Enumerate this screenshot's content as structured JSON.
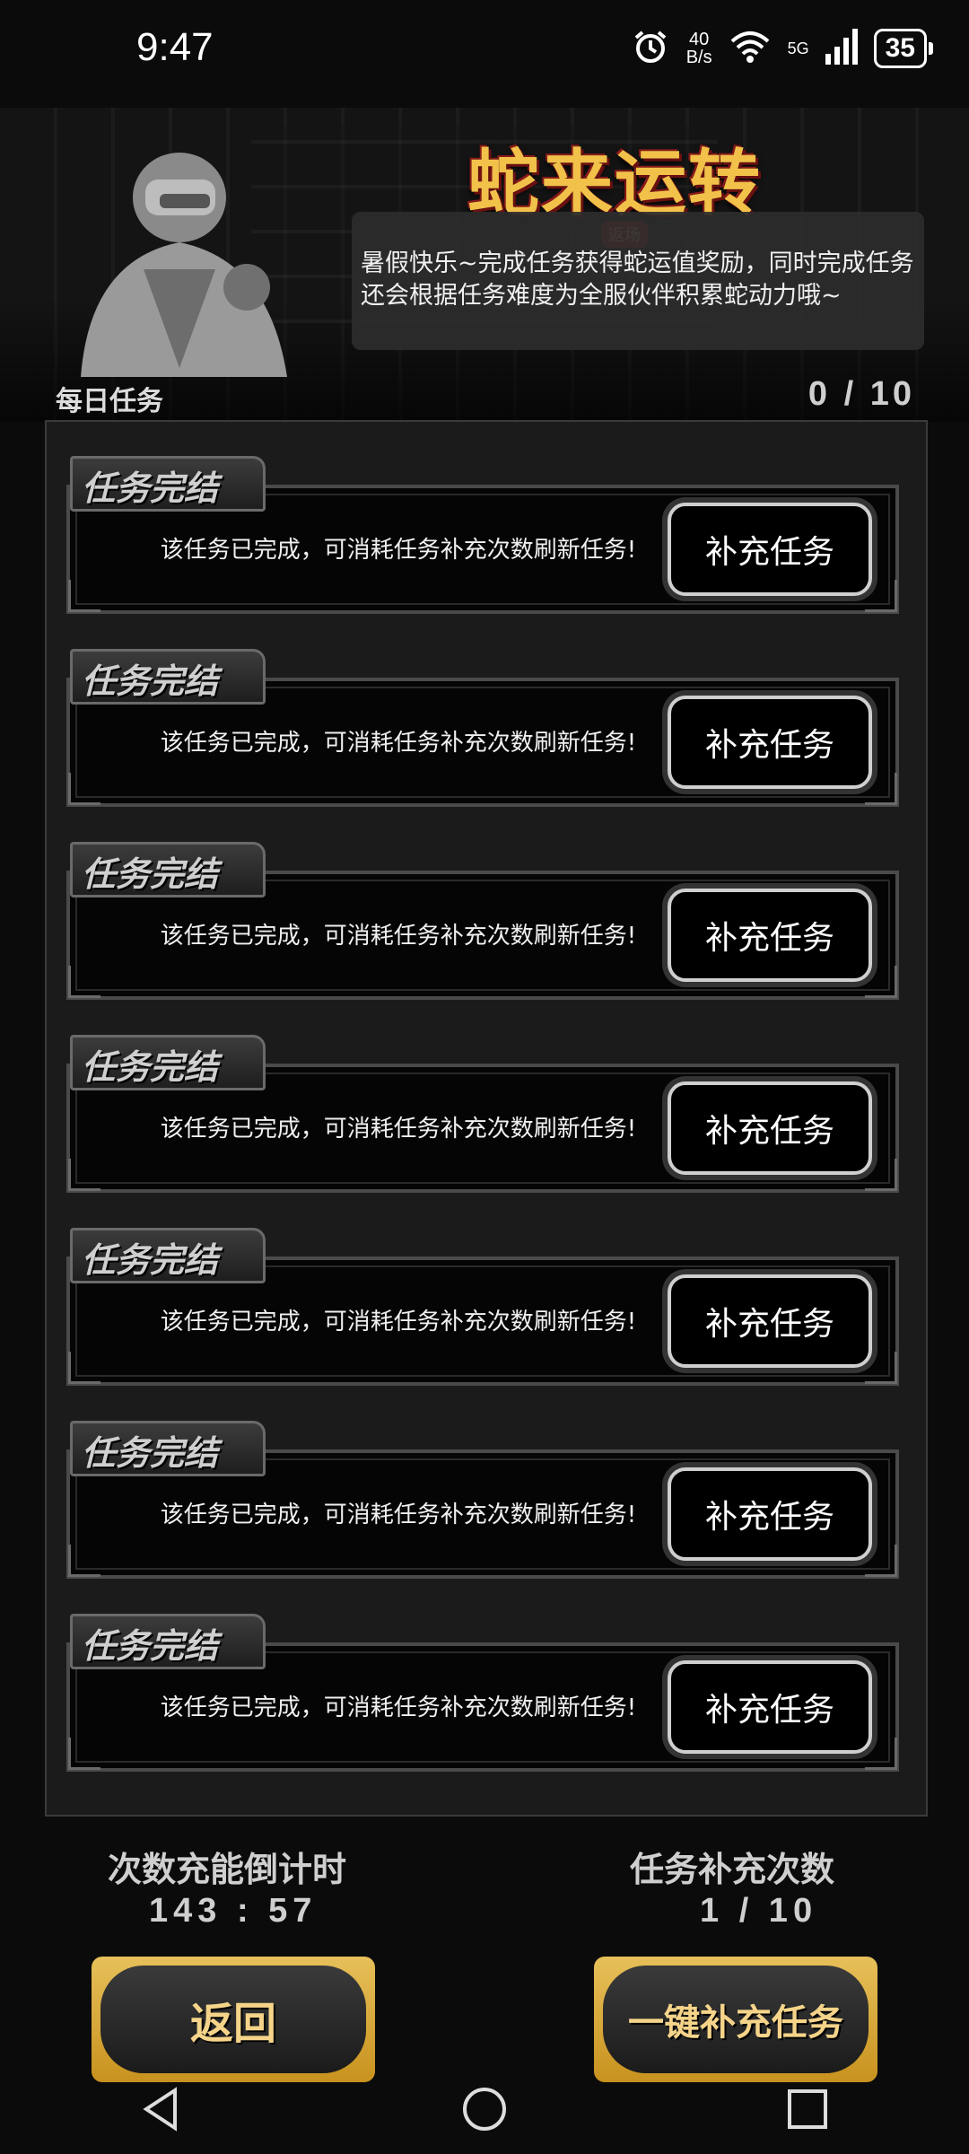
{
  "status_bar": {
    "time": "9:47",
    "net_speed_value": "40",
    "net_speed_unit": "B/s",
    "signal": "5G",
    "battery": "35",
    "icons": [
      "alarm-icon",
      "wifi-icon",
      "cell-signal-icon",
      "battery-icon"
    ]
  },
  "banner": {
    "logo_title": "蛇来运转",
    "logo_sub": "返场",
    "intro": "暑假快乐~完成任务获得蛇运值奖励，同时完成任务还会根据任务难度为全服伙伴积累蛇动力哦~"
  },
  "daily": {
    "label": "每日任务",
    "count": "0 / 10"
  },
  "tasks": [
    {
      "tag": "任务完结",
      "desc": "该任务已完成，可消耗任务补充次数刷新任务!",
      "button": "补充任务"
    },
    {
      "tag": "任务完结",
      "desc": "该任务已完成，可消耗任务补充次数刷新任务!",
      "button": "补充任务"
    },
    {
      "tag": "任务完结",
      "desc": "该任务已完成，可消耗任务补充次数刷新任务!",
      "button": "补充任务"
    },
    {
      "tag": "任务完结",
      "desc": "该任务已完成，可消耗任务补充次数刷新任务!",
      "button": "补充任务"
    },
    {
      "tag": "任务完结",
      "desc": "该任务已完成，可消耗任务补充次数刷新任务!",
      "button": "补充任务"
    },
    {
      "tag": "任务完结",
      "desc": "该任务已完成，可消耗任务补充次数刷新任务!",
      "button": "补充任务"
    },
    {
      "tag": "任务完结",
      "desc": "该任务已完成，可消耗任务补充次数刷新任务!",
      "button": "补充任务"
    }
  ],
  "stats": {
    "countdown_label": "次数充能倒计时",
    "countdown_value": "143 : 57",
    "refill_label": "任务补充次数",
    "refill_value": "1 / 10"
  },
  "buttons": {
    "back": "返回",
    "refill_all": "一键补充任务"
  },
  "colors": {
    "accent_gold": "#e7c05a",
    "logo_red": "#b51f1f"
  }
}
